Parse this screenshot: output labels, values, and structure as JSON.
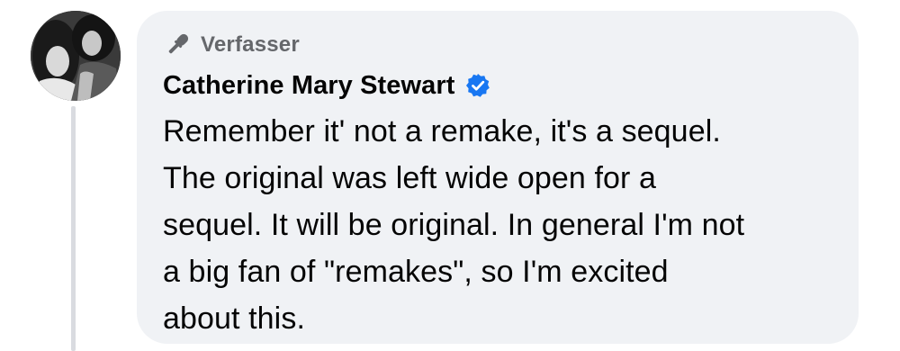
{
  "comment": {
    "author_badge": {
      "icon": "microphone-icon",
      "label": "Verfasser"
    },
    "author_name": "Catherine Mary Stewart",
    "verified_icon": "verified-badge-icon",
    "text": "Remember it' not a remake, it's a sequel.\nThe original was left wide open for a\nsequel. It will be original. In general I'm not\na big fan of \"remakes\", so I'm excited\nabout this."
  },
  "colors": {
    "bubble_background": "#f0f2f5",
    "badge_text": "#65676b",
    "name_text": "#050505",
    "verified_blue": "#1877f2",
    "thread_line": "#d9dbe0"
  }
}
